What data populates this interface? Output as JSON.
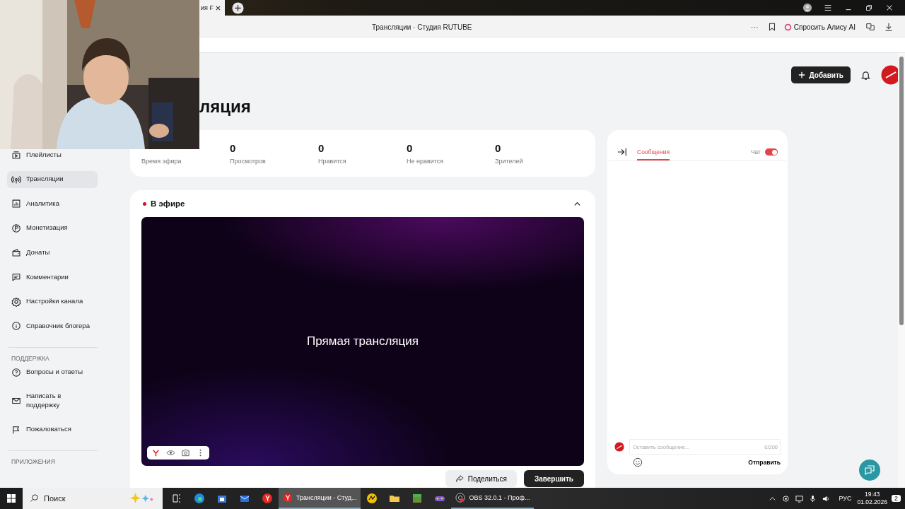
{
  "browser": {
    "tab_fragment": "ия F",
    "page_title": "Трансляции · Студия RUTUBE",
    "more": "···",
    "alice_button": "Спросить Алису AI"
  },
  "header": {
    "add_button": "Добавить"
  },
  "page_title_fragment": "ляция",
  "sidebar": {
    "groups": [
      {
        "items": [
          {
            "label": "Плейлисты",
            "selected": false
          },
          {
            "label": "Трансляции",
            "selected": true
          },
          {
            "label": "Аналитика",
            "selected": false
          },
          {
            "label": "Монетизация",
            "selected": false
          },
          {
            "label": "Донаты",
            "selected": false
          },
          {
            "label": "Комментарии",
            "selected": false
          },
          {
            "label": "Настройки канала",
            "selected": false
          },
          {
            "label": "Справочник блогера",
            "selected": false
          }
        ]
      },
      {
        "heading": "ПОДДЕРЖКА",
        "items": [
          {
            "label": "Вопросы и ответы",
            "selected": false
          },
          {
            "label": "Написать в поддержку",
            "selected": false
          },
          {
            "label": "Пожаловаться",
            "selected": false
          }
        ]
      },
      {
        "heading": "ПРИЛОЖЕНИЯ"
      }
    ]
  },
  "stats": [
    {
      "label": "Время эфира"
    },
    {
      "value": "0",
      "label": "Просмотров"
    },
    {
      "value": "0",
      "label": "Нравится"
    },
    {
      "value": "0",
      "label": "Не нравится"
    },
    {
      "value": "0",
      "label": "Зрителей"
    }
  ],
  "live": {
    "status": "В эфире",
    "on_air": true,
    "expanded": true,
    "video_title": "Прямая трансляция",
    "share_button": "Поделиться",
    "finish_button": "Завершить"
  },
  "chat": {
    "tab": "Сообщения",
    "tab_selected": true,
    "toggle_label": "Чат",
    "chat_on": true,
    "placeholder": "Оставить сообщение...",
    "counter": "0/200",
    "send_button": "Отправить"
  },
  "taskbar": {
    "search_placeholder": "Поиск",
    "apps": [
      {
        "label": "Трансляции - Студ...",
        "selected": true
      },
      {
        "label": "OBS 32.0.1 - Проф...",
        "selected": false
      }
    ],
    "language": "РУС",
    "time": "19:43",
    "date": "01.02.2026",
    "notifications": "2"
  }
}
